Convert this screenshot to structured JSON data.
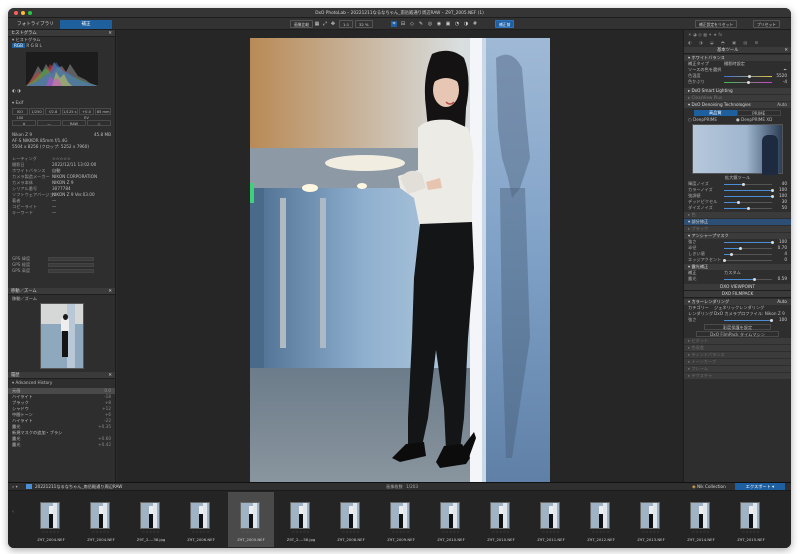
{
  "window": {
    "title": "DxO PhotoLab – 20221211なるなちゃん_南岳殿通り周辺RAW – Z9T_2005.NEF (1)"
  },
  "toolbar": {
    "tab_library": "フォトライブラリ",
    "tab_customize": "補正",
    "compare_label": "画像比較",
    "zoom_label": "1:1",
    "zoom_value": "32 %",
    "before_after": "前後",
    "fit_label": "フィット",
    "original_label": "補正前",
    "reset_label": "補正設定をリセット",
    "presets_label": "プリセット"
  },
  "left": {
    "histogram_title": "ヒストグラム",
    "channels": [
      "RGB",
      "R",
      "G",
      "B",
      "L"
    ],
    "exif_title": "Exif",
    "exif_values": [
      "ISO 100",
      "1/250",
      "f/2.8",
      "1/125 s",
      "+0.0 EV",
      "85 mm"
    ],
    "mode_buttons": [
      "A",
      "—",
      "RAW",
      "◇"
    ],
    "camera": "Nikon Z 9",
    "size": "45.8 MB",
    "lens": "AF-S NIKKOR 85mm f/1.4G",
    "dims": "5504 x 8256 (クロップ: 5252 x 7960)",
    "info_rows": [
      {
        "k": "レーティング",
        "v": "☆☆☆☆☆"
      },
      {
        "k": "撮影日",
        "v": "2022/12/11 13:02:00"
      },
      {
        "k": "ホワイトバランス",
        "v": "自動"
      },
      {
        "k": "カメラ製造メーカー",
        "v": "NIKON CORPORATION"
      },
      {
        "k": "カメラ本体",
        "v": "NIKON Z 9"
      },
      {
        "k": "シリアル番号",
        "v": "3077784"
      },
      {
        "k": "ソフトウェアバージョン",
        "v": "NIKON Z 9 Ver.03.00"
      },
      {
        "k": "著者",
        "v": "—"
      },
      {
        "k": "コピーライト",
        "v": "—"
      },
      {
        "k": "キーワード",
        "v": "—"
      }
    ],
    "gps_rows": [
      "GPS 緯度",
      "GPS 経度",
      "GPS 高度"
    ],
    "nav_title": "移動／ズーム",
    "nav_label": "移動／ズーム",
    "history_title": "履歴",
    "history_sub": "Advanced History",
    "history_rows": [
      {
        "k": "元画",
        "v": "0.0"
      },
      {
        "k": "ハイライト",
        "v": "-18"
      },
      {
        "k": "ブラック",
        "v": "+8"
      },
      {
        "k": "シャドウ",
        "v": "+12"
      },
      {
        "k": "中間トーン",
        "v": "+6"
      },
      {
        "k": "ハイライト",
        "v": "-22"
      },
      {
        "k": "露光",
        "v": "+0.35"
      },
      {
        "k": "新規マスクの追加・ブラシ",
        "v": ""
      },
      {
        "k": "露光",
        "v": "+0.60"
      },
      {
        "k": "露光",
        "v": "+0.42"
      }
    ]
  },
  "right": {
    "basic_tools": "基本ツール",
    "wb_title": "ホワイトバランス",
    "wb_preset_k": "補正タイプ",
    "wb_preset_v": "撮影時設定",
    "wb_picker": "ソースの色を選択",
    "temp_label": "色温度",
    "temp_value": "5520",
    "tint_label": "色かぶり",
    "tint_value": "-4",
    "smart_lighting": "DxO Smart Lighting",
    "clearview": "ClearView Plus",
    "denoise_title": "DxO Denoising Technologies",
    "denoise_mode": "Auto",
    "tab_hq": "高品質",
    "tab_prime": "PRIME",
    "opt_deepprime": "DeepPRIME",
    "opt_deepprime_xd": "DeepPRIME XD",
    "preview_label": "拡大鏡ツール",
    "denoise_sliders": [
      {
        "k": "輝度ノイズ",
        "v": "40"
      },
      {
        "k": "カラーノイズ",
        "v": "100"
      },
      {
        "k": "強調値",
        "v": "100"
      },
      {
        "k": "デッドピクセル",
        "v": "30"
      },
      {
        "k": "ダイズノイズ",
        "v": "50"
      }
    ],
    "sec_a": "色",
    "sec_b": "部分修正",
    "sec_c": "ブラック",
    "unsharp_title": "アンシャープマスク",
    "unsharp_rows": [
      {
        "k": "強さ",
        "v": "100"
      },
      {
        "k": "半径",
        "v": "0.70"
      },
      {
        "k": "しきい値",
        "v": "4"
      },
      {
        "k": "エッジアクセント",
        "v": "0"
      }
    ],
    "lens_title": "露光補正",
    "lens_rows": [
      {
        "k": "補正",
        "v": "カスタム"
      },
      {
        "k": "露光",
        "v": "0.59"
      }
    ],
    "viewpoint": "DXO VIEWPOINT",
    "filmpack": "DXO FILMPACK",
    "color_rendering": "カラーレンダリング",
    "cr_mode": "Auto",
    "cr_category_k": "カテゴリー",
    "cr_category_v": "ジェネリックレンダリング",
    "cr_render_k": "レンダリング",
    "cr_render_v": "DxO カメラプロファイル: Nikon Z 9",
    "cr_strength_k": "強さ",
    "cr_strength_v": "100",
    "protect_btn": "彩度保護を設定",
    "filmpack_btn": "DxO FilmPack タイムマシン",
    "dim_items": [
      "ビネット",
      "色収差",
      "ティントバランス",
      "トーンカーブ",
      "フレーム",
      "テクスチャ"
    ]
  },
  "filmstrip": {
    "folder": "20221211なるなちゃん_南岳殿通り周辺RAW",
    "count_label": "画像枚数",
    "count": "1/203",
    "nik": "Nik Collection",
    "export": "エクスポート",
    "thumbs": [
      "Z9T_2004.NEF",
      "Z9T_2004.NEF",
      "Z9T_2-...38.jpg",
      "Z9T_2006.NEF",
      "Z9T_2005.NEF",
      "Z9T_2-...58.jpg",
      "Z9T_2008.NEF",
      "Z9T_2009.NEF",
      "Z9T_2010.NEF",
      "Z9T_2010.NEF",
      "Z9T_2011.NEF",
      "Z9T_2012.NEF",
      "Z9T_2013.NEF",
      "Z9T_2014.NEF",
      "Z9T_2015.NEF"
    ],
    "stars": "☆☆☆☆☆"
  }
}
